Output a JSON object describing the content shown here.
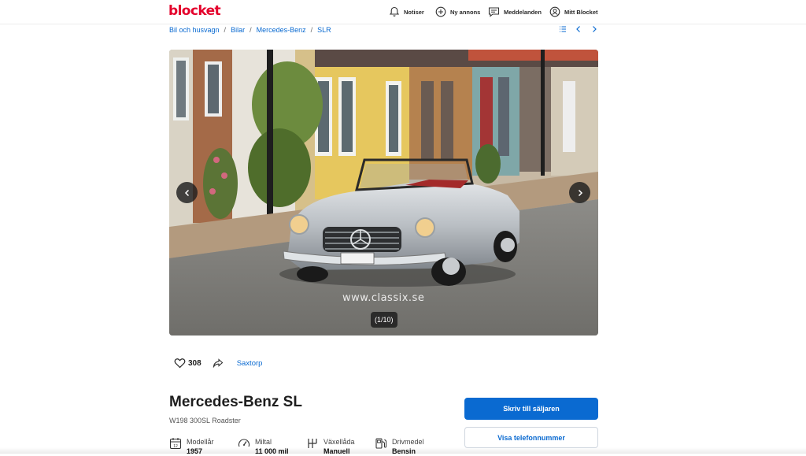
{
  "header": {
    "logo": "blocket",
    "nav": [
      {
        "label": "Notiser",
        "icon": "bell-icon"
      },
      {
        "label": "Ny annons",
        "icon": "plus-circle-icon"
      },
      {
        "label": "Meddelanden",
        "icon": "chat-icon"
      },
      {
        "label": "Mitt Blocket",
        "icon": "user-icon"
      }
    ]
  },
  "breadcrumb": [
    "Bil och husvagn",
    "Bilar",
    "Mercedes-Benz",
    "SLR"
  ],
  "gallery": {
    "counter": "(1/10)",
    "watermark": "www.classix.se"
  },
  "actions": {
    "likes": "308",
    "location": "Saxtorp"
  },
  "listing": {
    "title": "Mercedes-Benz SL",
    "subtitle": "W198 300SL Roadster",
    "specs": [
      {
        "label": "Modellår",
        "value": "1957",
        "icon": "calendar-icon"
      },
      {
        "label": "Miltal",
        "value": "11 000 mil",
        "icon": "speedometer-icon"
      },
      {
        "label": "Växellåda",
        "value": "Manuell",
        "icon": "gearbox-icon"
      },
      {
        "label": "Drivmedel",
        "value": "Bensin",
        "icon": "fuel-pump-icon"
      }
    ]
  },
  "seller": {
    "message_button": "Skriv till säljaren",
    "phone_button": "Visa telefonnummer"
  },
  "colors": {
    "brand": "#e4002b",
    "link": "#0a6ad1",
    "primary_button": "#0a6ad1"
  }
}
